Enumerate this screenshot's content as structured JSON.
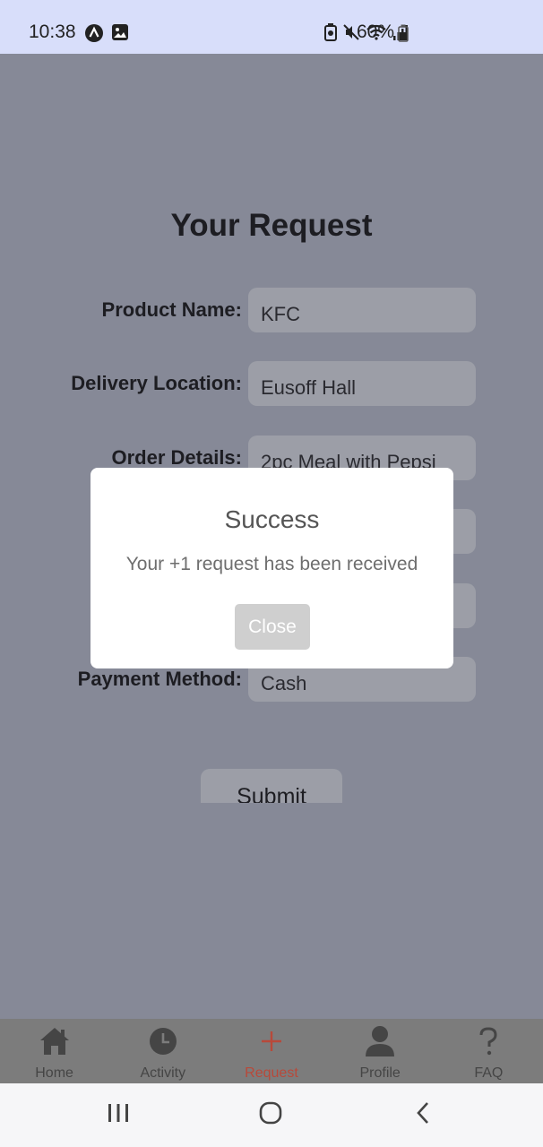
{
  "status_bar": {
    "time": "10:38",
    "battery": "60%",
    "left_icons": [
      "app-a-icon",
      "gallery-icon"
    ],
    "right_icons": [
      "battery-saver-icon",
      "mute-icon",
      "wifi-icon",
      "signal-icon",
      "battery-icon"
    ]
  },
  "page": {
    "title": "Your Request"
  },
  "form": {
    "fields": [
      {
        "label": "Product Name:",
        "value": "KFC"
      },
      {
        "label": "Delivery Location:",
        "value": "Eusoff Hall"
      },
      {
        "label": "Order Details:",
        "value": "2pc Meal with Pepsi"
      },
      {
        "label": "",
        "value": ""
      },
      {
        "label": "D",
        "value": ""
      },
      {
        "label": "Payment Method:",
        "value": "Cash"
      }
    ],
    "submit_label": "Submit"
  },
  "modal": {
    "title": "Success",
    "message": "Your +1 request has been received",
    "close_label": "Close"
  },
  "tabs": [
    {
      "label": "Home",
      "icon": "home-icon",
      "active": false
    },
    {
      "label": "Activity",
      "icon": "clock-icon",
      "active": false
    },
    {
      "label": "Request",
      "icon": "plus-icon",
      "active": true
    },
    {
      "label": "Profile",
      "icon": "person-icon",
      "active": false
    },
    {
      "label": "FAQ",
      "icon": "question-icon",
      "active": false
    }
  ],
  "colors": {
    "accent": "#b8493a",
    "overlay": "#868997",
    "status_bar": "#d8defa"
  }
}
